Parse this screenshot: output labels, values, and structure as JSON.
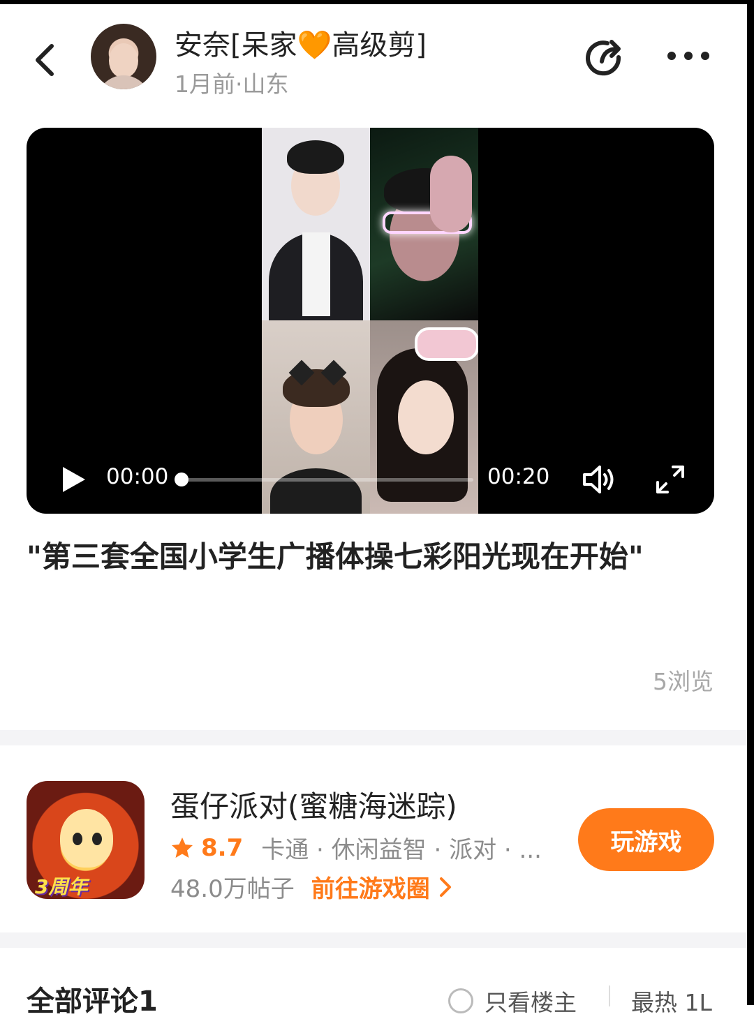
{
  "header": {
    "author_name": "安奈[呆家",
    "author_heart": "🧡",
    "author_name_suffix": "高级剪]",
    "meta": "1月前·山东"
  },
  "video": {
    "current_time": "00:00",
    "total_time": "00:20",
    "progress": 0.0
  },
  "post": {
    "text": "\"第三套全国小学生广播体操七彩阳光现在开始\"",
    "views": "5浏览"
  },
  "game": {
    "icon_badge": "3周年",
    "title": "蛋仔派对(蜜糖海迷踪)",
    "rating": "8.7",
    "tags": "卡通 · 休闲益智 · 派对 · ...",
    "posts": "48.0万帖子",
    "goto_label": "前往游戏圈",
    "play_label": "玩游戏"
  },
  "comments": {
    "title": "全部评论1",
    "only_op_label": "只看楼主",
    "sort_label": "最热 1L"
  },
  "colors": {
    "accent": "#ff7a1a",
    "muted": "#9a9a9a"
  }
}
